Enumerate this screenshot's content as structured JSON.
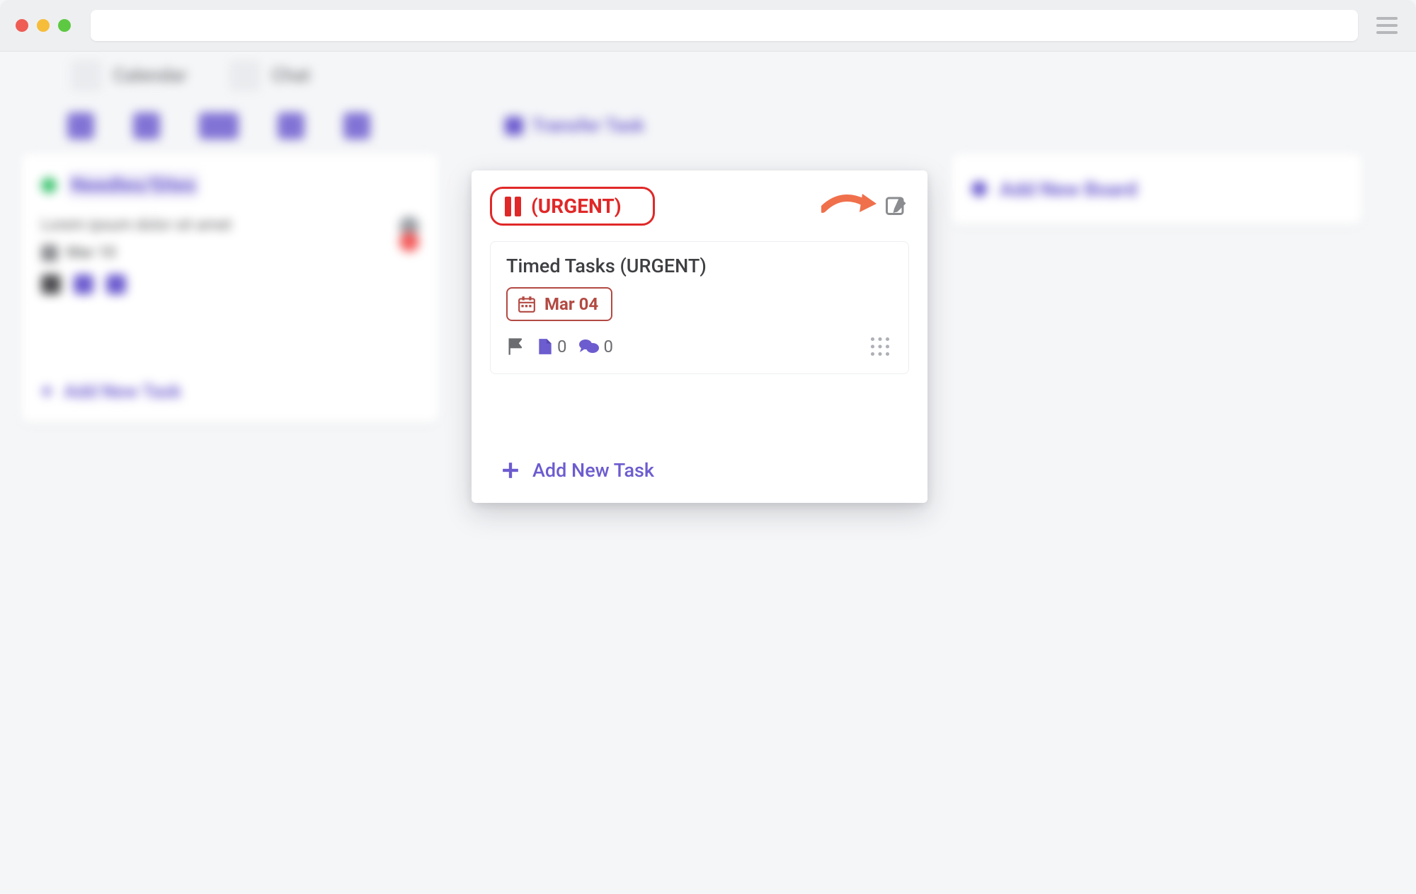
{
  "browser": {
    "hamburger_name": "menu-icon"
  },
  "nav": {
    "calendar_label": "Calendar",
    "chat_label": "Chat"
  },
  "toolbar": {
    "transfer_label": "Transfer Task"
  },
  "blurred_board_left": {
    "title": "Needles/Sites",
    "task_text": "Lorem ipsum dolor sit amet",
    "date_label": "Mar 10",
    "add_task_label": "Add New Task"
  },
  "blurred_board_right": {
    "add_board_label": "Add New Board"
  },
  "focus_board": {
    "header_label": "(URGENT)",
    "task": {
      "title": "Timed Tasks (URGENT)",
      "date_label": "Mar 04",
      "files_count": "0",
      "comments_count": "0"
    },
    "add_task_label": "Add New Task"
  },
  "colors": {
    "accent": "#6c5ccf",
    "danger": "#e02828",
    "date_danger": "#b34a43"
  }
}
